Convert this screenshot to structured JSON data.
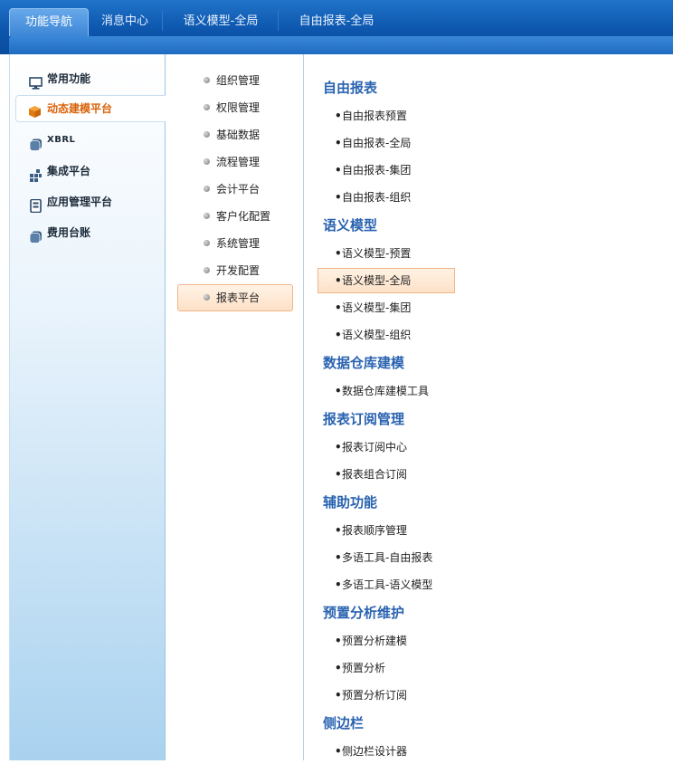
{
  "top_tabs": [
    "功能导航",
    "消息中心",
    "语义模型-全局",
    "自由报表-全局"
  ],
  "left_menu": [
    {
      "label": "常用功能",
      "icon": "monitor-icon"
    },
    {
      "label": "动态建模平台",
      "icon": "cube-icon"
    },
    {
      "label": "XBRL",
      "icon": "stack-icon"
    },
    {
      "label": "集成平台",
      "icon": "grid-icon"
    },
    {
      "label": "应用管理平台",
      "icon": "server-icon"
    },
    {
      "label": "费用台账",
      "icon": "stack-icon"
    }
  ],
  "mid_menu": [
    "组织管理",
    "权限管理",
    "基础数据",
    "流程管理",
    "会计平台",
    "客户化配置",
    "系统管理",
    "开发配置",
    "报表平台"
  ],
  "groups": [
    {
      "title": "自由报表",
      "items": [
        "自由报表预置",
        "自由报表-全局",
        "自由报表-集团",
        "自由报表-组织"
      ]
    },
    {
      "title": "语义模型",
      "items": [
        "语义模型-预置",
        "语义模型-全局",
        "语义模型-集团",
        "语义模型-组织"
      ]
    },
    {
      "title": "数据仓库建模",
      "items": [
        "数据仓库建模工具"
      ]
    },
    {
      "title": "报表订阅管理",
      "items": [
        "报表订阅中心",
        "报表组合订阅"
      ]
    },
    {
      "title": "辅助功能",
      "items": [
        "报表顺序管理",
        "多语工具-自由报表",
        "多语工具-语义模型"
      ]
    },
    {
      "title": "预置分析维护",
      "items": [
        "预置分析建模",
        "预置分析",
        "预置分析订阅"
      ]
    },
    {
      "title": "侧边栏",
      "items": [
        "侧边栏设计器"
      ]
    }
  ],
  "bullet": "•",
  "colors": {
    "accent": "#2a63b0",
    "active_orange": "#d9620a",
    "header_blue": "#0d56ad"
  }
}
